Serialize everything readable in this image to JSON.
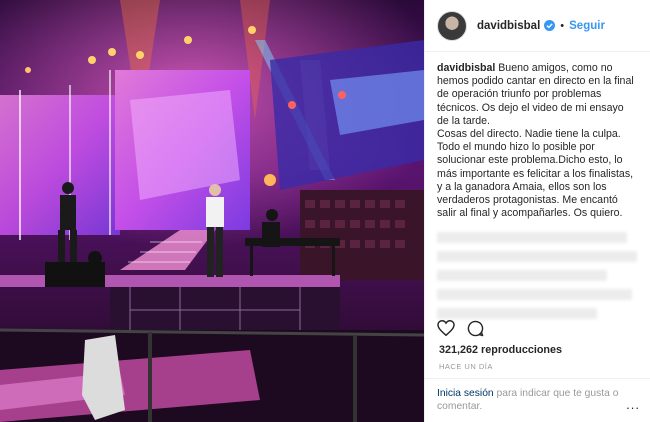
{
  "post": {
    "username": "davidbisbal",
    "follow_label": "Seguir",
    "dot": "•",
    "caption_lines": [
      "Bueno amigos, como no hemos podido cantar en directo en la final de operación triunfo por problemas técnicos. Os dejo el video de mi ensayo de la tarde.",
      "Cosas del directo. Nadie tiene la culpa. Todo el mundo hizo lo posible por solucionar este problema.Dicho esto, lo más importante es felicitar a los finalistas, y a la ganadora Amaia, ellos son los verdaderos protagonistas. Me encantó salir al final y acompañarles. Os quiero."
    ],
    "views": "321,262 reproducciones",
    "time": "HACE UN DÍA",
    "login_link": "Inicia sesión",
    "login_text": " para indicar que te gusta o comentar.",
    "more": "..."
  },
  "icons": {
    "verified": "verified-badge-icon",
    "like": "heart-icon",
    "comment": "comment-icon",
    "more": "more-options-icon"
  },
  "colors": {
    "link_blue": "#3897f0",
    "text": "#262626",
    "muted": "#999999",
    "dark_link": "#003569"
  }
}
